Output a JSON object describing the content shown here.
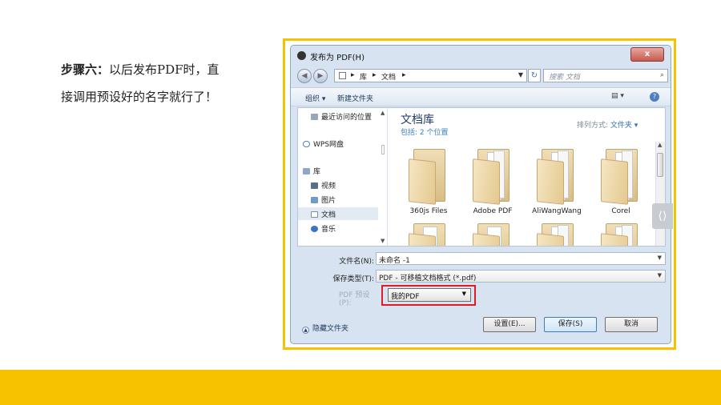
{
  "instruction": {
    "step_label": "步骤六：",
    "text_line1": "以后发布PDF时，直",
    "text_line2": "接调用预设好的名字就行了！"
  },
  "colors": {
    "accent_yellow": "#f7c200",
    "highlight_red": "#e01b24",
    "dialog_blue": "#d7e3f1"
  },
  "dialog": {
    "title": "发布为 PDF(H)",
    "close_label": "x",
    "address": {
      "crumbs": [
        "库",
        "文档"
      ],
      "separator": "▸"
    },
    "search_placeholder": "搜索 文档",
    "toolbar": {
      "organize": "组织 ▾",
      "new_folder": "新建文件夹"
    },
    "nav": {
      "items": [
        {
          "label": "最近访问的位置",
          "icon": "recent-icon"
        },
        {
          "label": "WPS网盘",
          "icon": "cloud-icon"
        },
        {
          "label": "库",
          "icon": "library-icon"
        },
        {
          "label": "视频",
          "icon": "video-icon"
        },
        {
          "label": "图片",
          "icon": "picture-icon"
        },
        {
          "label": "文档",
          "icon": "document-icon"
        },
        {
          "label": "音乐",
          "icon": "music-icon"
        }
      ]
    },
    "library": {
      "title": "文档库",
      "subtitle": "包括: 2 个位置",
      "arrange_label": "排列方式:",
      "arrange_value": "文件夹 ▾"
    },
    "folders": [
      {
        "label": "360js Files"
      },
      {
        "label": "Adobe PDF"
      },
      {
        "label": "AliWangWang"
      },
      {
        "label": "Corel"
      }
    ],
    "fields": {
      "filename_label": "文件名(N):",
      "filename_value": "未命名 -1",
      "filetype_label": "保存类型(T):",
      "filetype_value": "PDF - 可移植文档格式 (*.pdf)",
      "preset_label": "PDF 预设(P):",
      "preset_value": "我的PDF"
    },
    "hide_folders": "隐藏文件夹",
    "buttons": {
      "settings": "设置(E)...",
      "save": "保存(S)",
      "cancel": "取消"
    }
  }
}
